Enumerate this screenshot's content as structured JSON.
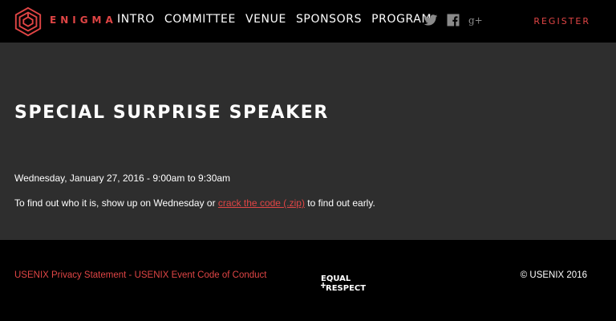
{
  "brand": {
    "name": "ENIGMA",
    "accent_color": "#e04545",
    "logo_icon": "enigma-hex-logo-icon"
  },
  "nav": {
    "items": [
      {
        "label": "INTRO"
      },
      {
        "label": "COMMITTEE"
      },
      {
        "label": "VENUE"
      },
      {
        "label": "SPONSORS"
      },
      {
        "label": "PROGRAM"
      }
    ],
    "social": [
      {
        "icon": "twitter-icon"
      },
      {
        "icon": "facebook-icon"
      },
      {
        "icon": "google-plus-icon"
      }
    ],
    "register_label": "REGISTER"
  },
  "main": {
    "title": "SPECIAL SURPRISE SPEAKER",
    "session_time": "Wednesday, January 27, 2016 - 9:00am to 9:30am",
    "desc_before": "To find out who it is, show up on Wednesday or ",
    "desc_link": "crack the code (.zip)",
    "desc_after": " to find out early."
  },
  "footer": {
    "privacy_link": "USENIX Privacy Statement",
    "separator": " - ",
    "conduct_link": "USENIX Event Code of Conduct",
    "equal_respect_logo_text_1": "EQUAL",
    "equal_respect_logo_text_2": "RESPECT",
    "copyright": "© USENIX 2016"
  }
}
